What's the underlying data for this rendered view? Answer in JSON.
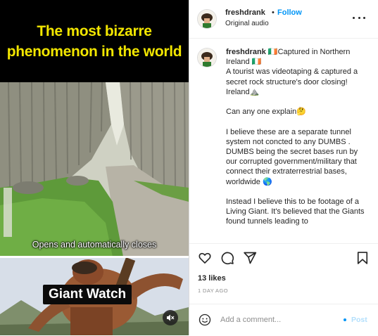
{
  "video": {
    "title_line1": "The most bizarre",
    "title_line2": "phenomenon in the world",
    "subtitle": "Opens and automatically closes",
    "badge": "Giant Watch",
    "mute_icon": "speaker-muted-icon"
  },
  "post": {
    "username": "freshdrank",
    "separator": "•",
    "follow_label": "Follow",
    "audio_label": "Original audio",
    "more_icon": "more-options-icon",
    "caption": {
      "username": "freshdrank",
      "line1": "🇮🇪Captured in Northern Ireland 🇮🇪",
      "p1": "A tourist was videotaping & captured a secret rock structure's door closing! Ireland⛰️",
      "p2": "Can any one explain🤔",
      "p3": "I believe these are a separate tunnel system not concted to any DUMBS . DUMBS being the secret bases run by our corrupted government/military that connect their extraterrestrial bases, worldwide 🌎",
      "p4": "Instead I believe this to be footage of a Living Giant. It's believed that the Giants found tunnels leading to"
    },
    "likes": "13 likes",
    "time_ago": "1 DAY AGO",
    "comment_placeholder": "Add a comment...",
    "post_label": "Post"
  },
  "colors": {
    "accent": "#0095f6",
    "title_yellow": "#f2e600",
    "post_disabled": "#b2dffc"
  }
}
